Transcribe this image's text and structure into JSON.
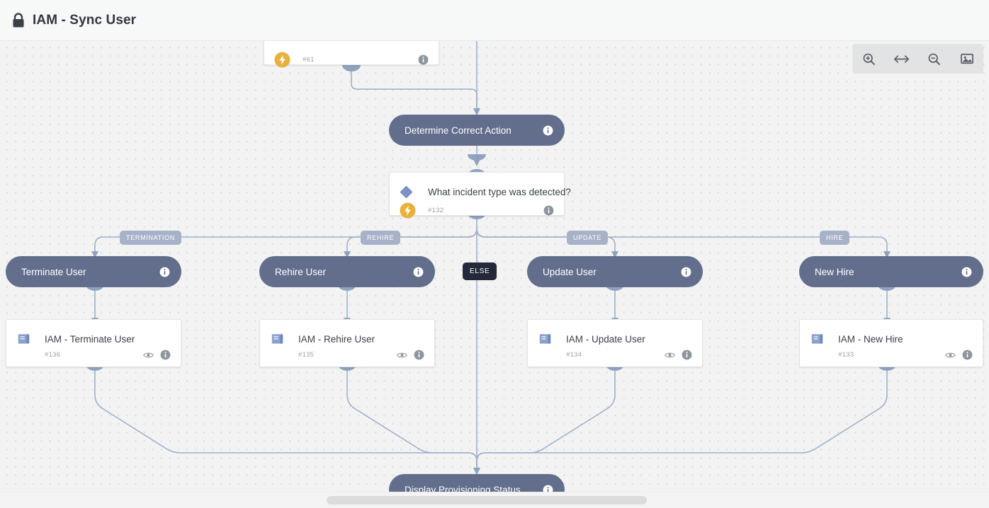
{
  "header": {
    "title": "IAM - Sync User",
    "lock_icon": "lock-icon"
  },
  "toolbar": {
    "buttons": [
      {
        "name": "zoom-in-icon",
        "label": "Zoom In"
      },
      {
        "name": "fit-width-icon",
        "label": "Fit Width"
      },
      {
        "name": "zoom-out-icon",
        "label": "Zoom Out"
      },
      {
        "name": "export-image-icon",
        "label": "Export Image"
      }
    ]
  },
  "canvas": {
    "nodes": {
      "top_trigger_card": {
        "id": "#61",
        "badge_icon": "bolt-icon",
        "info_icon": "info-icon"
      },
      "determine_action": {
        "label": "Determine Correct Action",
        "info_icon": "info-icon"
      },
      "decision": {
        "question": "What incident type was detected?",
        "id": "#132",
        "diamond_icon": "diamond-icon",
        "badge_icon": "bolt-icon",
        "info_icon": "info-icon"
      },
      "display_status": {
        "label": "Display Provisioning Status",
        "info_icon": "info-icon"
      }
    },
    "branches": [
      {
        "edge_label": "TERMINATION",
        "action_label": "Terminate User",
        "subflow_title": "IAM - Terminate User",
        "subflow_id": "#136",
        "subflow_icon": "subflow-icon",
        "eye_icon": "eye-icon",
        "info_icon": "info-icon"
      },
      {
        "edge_label": "REHIRE",
        "action_label": "Rehire User",
        "subflow_title": "IAM - Rehire User",
        "subflow_id": "#135",
        "subflow_icon": "subflow-icon",
        "eye_icon": "eye-icon",
        "info_icon": "info-icon"
      },
      {
        "edge_label": "UPDATE",
        "action_label": "Update User",
        "subflow_title": "IAM - Update User",
        "subflow_id": "#134",
        "subflow_icon": "subflow-icon",
        "eye_icon": "eye-icon",
        "info_icon": "info-icon"
      },
      {
        "edge_label": "HIRE",
        "action_label": "New Hire",
        "subflow_title": "IAM - New Hire",
        "subflow_id": "#133",
        "subflow_icon": "subflow-icon",
        "eye_icon": "eye-icon",
        "info_icon": "info-icon"
      }
    ],
    "else_label": "ELSE"
  },
  "colors": {
    "node_fill": "#636e8c",
    "edge_label_fill": "#a7b2c9",
    "else_fill": "#232938",
    "bolt_fill": "#e8b13d",
    "canvas_bg": "#f2f3f2",
    "edge_stroke": "#9fb0cb"
  }
}
